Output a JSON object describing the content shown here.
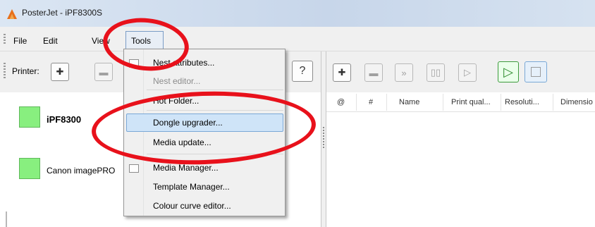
{
  "window": {
    "title": "PosterJet - iPF8300S"
  },
  "menubar": {
    "items": [
      "File",
      "Edit",
      "View",
      "Tools"
    ]
  },
  "toolbar_left": {
    "printer_label": "Printer:",
    "help_label": "?"
  },
  "printers": [
    {
      "name": "iPF8300",
      "status_color": "#88ef7f"
    },
    {
      "name": "Canon imagePRO",
      "status_color": "#88ef7f"
    }
  ],
  "job_table": {
    "columns": [
      "@",
      "#",
      "Name",
      "Print qual...",
      "Resoluti...",
      "Dimensio"
    ]
  },
  "tools_menu": {
    "items": [
      {
        "label": "Nest attributes...",
        "enabled": true,
        "icon": "nest-icon"
      },
      {
        "label": "Nest editor...",
        "enabled": false
      },
      {
        "label": "Hot Folder...",
        "enabled": true
      },
      {
        "label": "Dongle upgrader...",
        "enabled": true,
        "highlighted": true
      },
      {
        "label": "Media update...",
        "enabled": true
      },
      {
        "label": "Media Manager...",
        "enabled": true,
        "icon": "media-manager-icon"
      },
      {
        "label": "Template Manager...",
        "enabled": true
      },
      {
        "label": "Colour curve editor...",
        "enabled": true
      }
    ]
  },
  "colors": {
    "annotation": "#e8111b",
    "highlight": "#cfe4f8",
    "status_ok": "#88ef7f",
    "play_green": "#2c8a2c"
  }
}
